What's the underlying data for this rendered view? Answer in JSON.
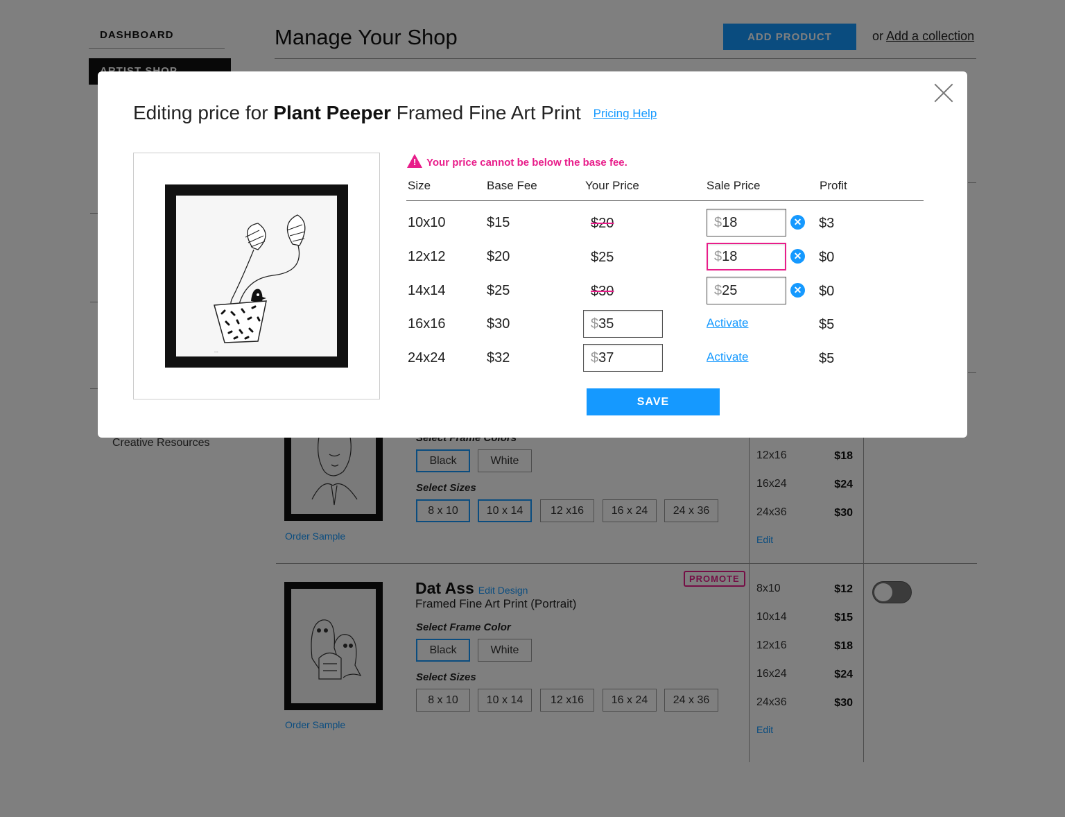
{
  "sidebar": {
    "dashboard": "DASHBOARD",
    "artist_shop": "ARTIST SHOP",
    "creative_resources": "Creative Resources"
  },
  "header": {
    "title": "Manage Your Shop",
    "add_product": "ADD PRODUCT",
    "or_text": "or",
    "add_collection": "Add a collection"
  },
  "products": [
    {
      "name": "",
      "order_sample": "Order Sample",
      "frame_label": "Select Frame Colors",
      "frame_colors": [
        "Black",
        "White"
      ],
      "sizes_label": "Select Sizes",
      "sizes": [
        "8 x 10",
        "10 x 14",
        "12 x16",
        "16 x 24",
        "24 x 36"
      ],
      "prices": [
        {
          "size": "12x16",
          "price": "$18"
        },
        {
          "size": "16x24",
          "price": "$24"
        },
        {
          "size": "24x36",
          "price": "$30"
        }
      ],
      "edit": "Edit"
    },
    {
      "name": "Dat Ass",
      "edit_design": "Edit Design",
      "subtitle": "Framed Fine Art Print (Portrait)",
      "promote": "PROMOTE",
      "order_sample": "Order Sample",
      "frame_label": "Select Frame Color",
      "frame_colors": [
        "Black",
        "White"
      ],
      "sizes_label": "Select Sizes",
      "sizes": [
        "8 x 10",
        "10 x 14",
        "12 x16",
        "16 x 24",
        "24 x 36"
      ],
      "prices": [
        {
          "size": "8x10",
          "price": "$12"
        },
        {
          "size": "10x14",
          "price": "$15"
        },
        {
          "size": "12x16",
          "price": "$18"
        },
        {
          "size": "16x24",
          "price": "$24"
        },
        {
          "size": "24x36",
          "price": "$30"
        }
      ],
      "edit": "Edit",
      "enabled": false
    }
  ],
  "modal": {
    "title_prefix": "Editing price for",
    "product_name": "Plant Peeper",
    "title_suffix": "Framed Fine Art Print",
    "pricing_help": "Pricing Help",
    "warning": "Your price cannot be below the base fee.",
    "warning_icon": "warning-triangle-icon",
    "columns": {
      "size": "Size",
      "base_fee": "Base Fee",
      "your_price": "Your Price",
      "sale_price": "Sale Price",
      "profit": "Profit"
    },
    "rows": [
      {
        "size": "10x10",
        "base_fee": "$15",
        "your_price": "$20",
        "sale_price": "18",
        "profit": "$3"
      },
      {
        "size": "12x12",
        "base_fee": "$20",
        "your_price": "$25",
        "sale_price": "18",
        "profit": "$0"
      },
      {
        "size": "14x14",
        "base_fee": "$25",
        "your_price": "$30",
        "sale_price": "25",
        "profit": "$0"
      },
      {
        "size": "16x16",
        "base_fee": "$30",
        "your_price": "35",
        "sale_action": "Activate",
        "profit": "$5"
      },
      {
        "size": "24x24",
        "base_fee": "$32",
        "your_price": "37",
        "sale_action": "Activate",
        "profit": "$5"
      }
    ],
    "currency": "$",
    "save": "SAVE",
    "colors": {
      "accent": "#1599ff",
      "error": "#e81d8a"
    }
  }
}
